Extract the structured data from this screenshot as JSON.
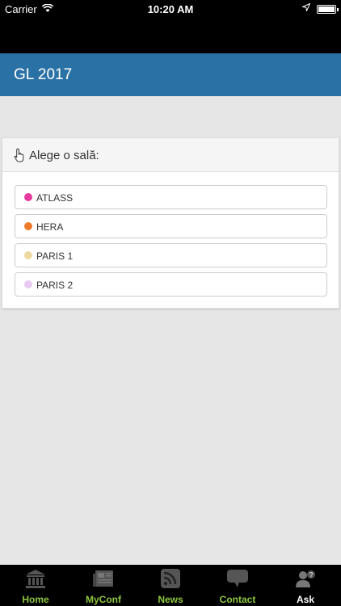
{
  "status_bar": {
    "carrier": "Carrier",
    "time": "10:20 AM"
  },
  "header": {
    "title": "GL 2017"
  },
  "card": {
    "title": "Alege o sală:",
    "rooms": [
      {
        "label": "ATLASS",
        "color": "#e8399e"
      },
      {
        "label": "HERA",
        "color": "#ef7a2a"
      },
      {
        "label": "PARIS 1",
        "color": "#eed9a0"
      },
      {
        "label": "PARIS 2",
        "color": "#e7c9f2"
      }
    ]
  },
  "tabs": [
    {
      "label": "Home",
      "icon": "home-icon",
      "color": "#8cc63f"
    },
    {
      "label": "MyConf",
      "icon": "newspaper-icon",
      "color": "#8cc63f"
    },
    {
      "label": "News",
      "icon": "rss-icon",
      "color": "#8cc63f"
    },
    {
      "label": "Contact",
      "icon": "chat-icon",
      "color": "#8cc63f"
    },
    {
      "label": "Ask",
      "icon": "user-question-icon",
      "color": "#ffffff"
    }
  ]
}
